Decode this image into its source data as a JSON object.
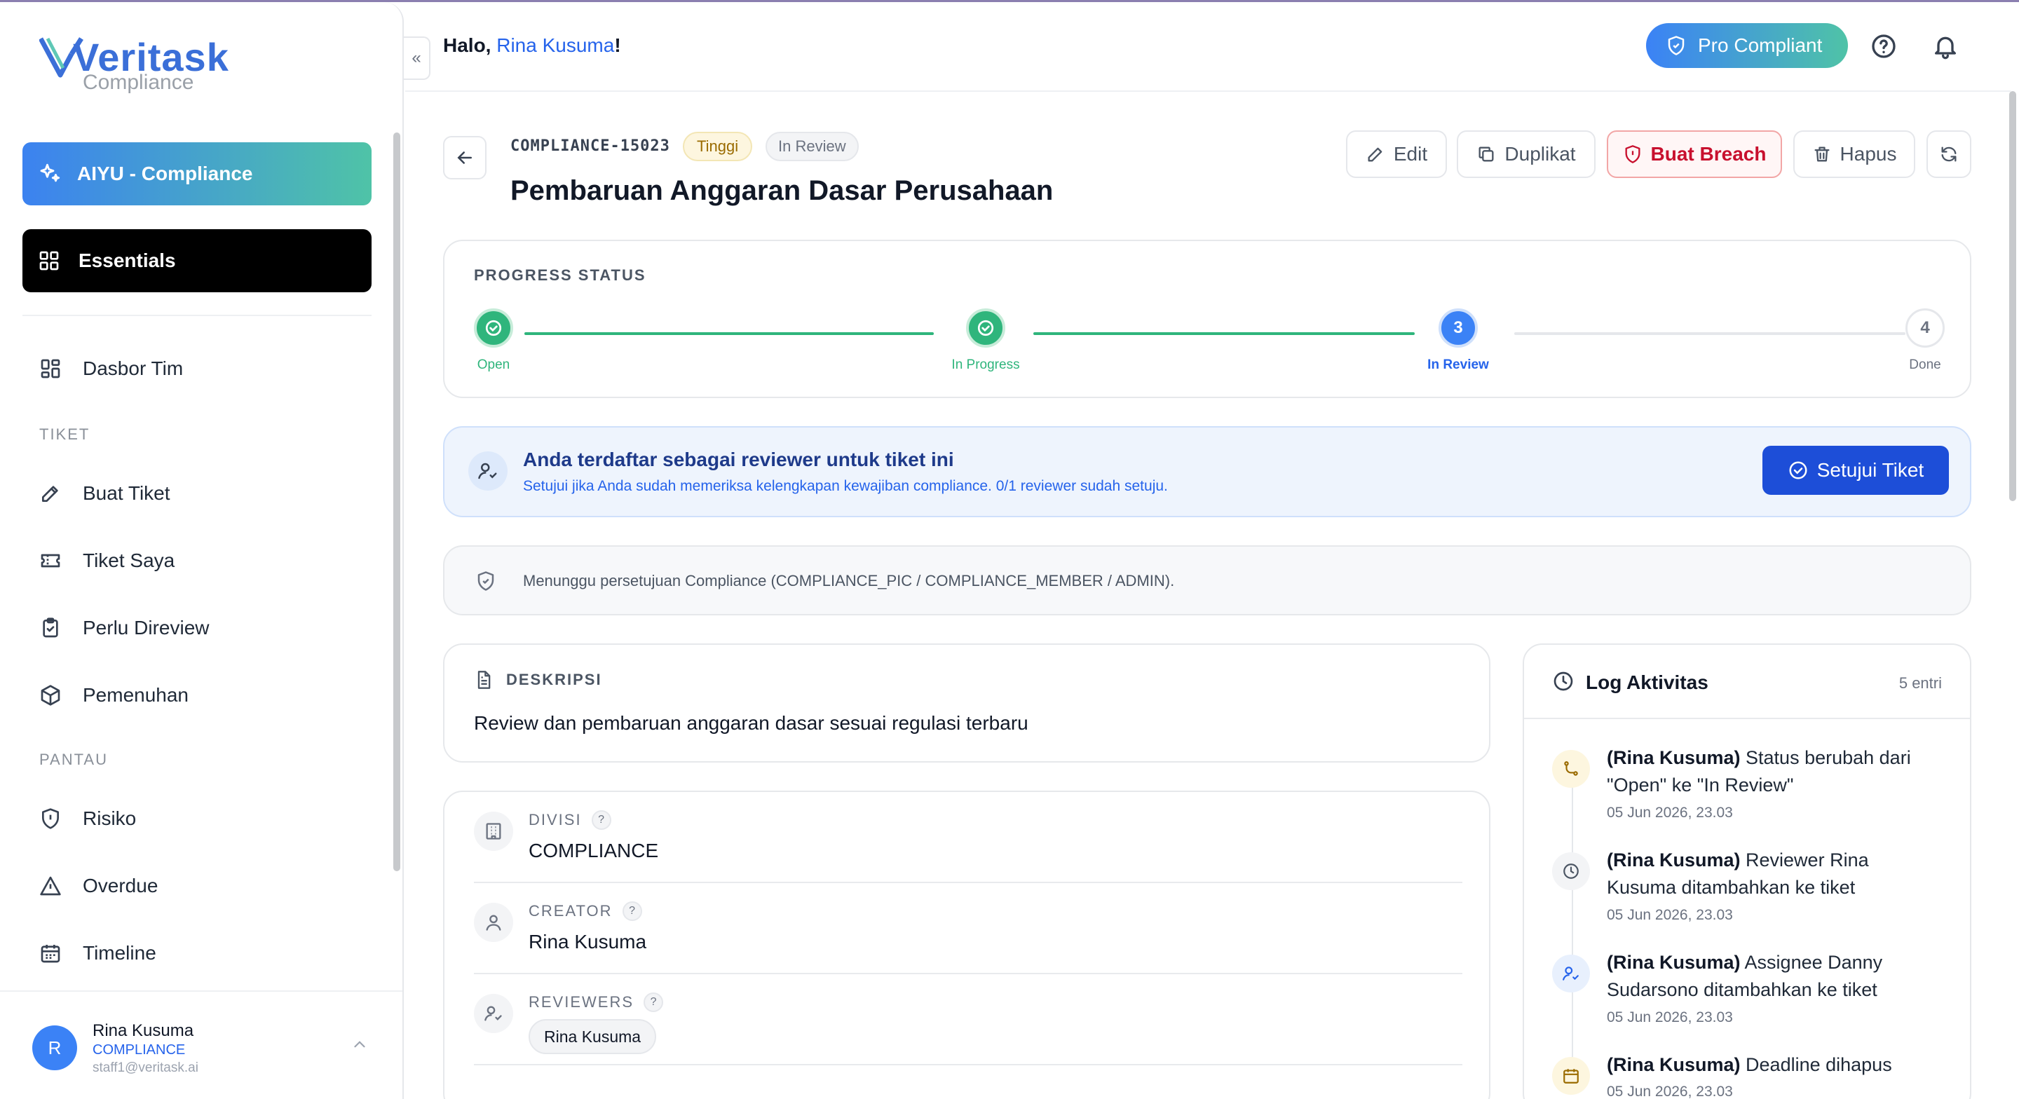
{
  "brand": {
    "name": "Veritask",
    "sub": "Compliance"
  },
  "sidebar": {
    "aiyu_label": "AIYU - Compliance",
    "essentials_label": "Essentials",
    "dashboard_label": "Dasbor Tim",
    "section_tiket": "TIKET",
    "items_tiket": [
      {
        "label": "Buat Tiket",
        "icon": "pencil-icon"
      },
      {
        "label": "Tiket Saya",
        "icon": "ticket-icon"
      },
      {
        "label": "Perlu Direview",
        "icon": "clipboard-icon"
      },
      {
        "label": "Pemenuhan",
        "icon": "package-icon"
      }
    ],
    "section_pantau": "PANTAU",
    "items_pantau": [
      {
        "label": "Risiko",
        "icon": "shield-icon"
      },
      {
        "label": "Overdue",
        "icon": "warning-icon"
      },
      {
        "label": "Timeline",
        "icon": "calendar-icon"
      }
    ],
    "collapse_glyph": "«",
    "user": {
      "initial": "R",
      "name": "Rina Kusuma",
      "division": "COMPLIANCE",
      "email": "staff1@veritask.ai"
    }
  },
  "header": {
    "greet_prefix": "Halo, ",
    "greet_name": "Rina Kusuma",
    "greet_suffix": "!",
    "plan_label": "Pro Compliant"
  },
  "ticket": {
    "id": "COMPLIANCE-15023",
    "priority": "Tinggi",
    "status": "In Review",
    "title": "Pembaruan Anggaran Dasar Perusahaan",
    "actions": {
      "edit": "Edit",
      "duplicate": "Duplikat",
      "breach": "Buat Breach",
      "delete": "Hapus"
    }
  },
  "progress": {
    "label": "PROGRESS STATUS",
    "steps": [
      {
        "label": "Open",
        "state": "done",
        "num": ""
      },
      {
        "label": "In Progress",
        "state": "done",
        "num": ""
      },
      {
        "label": "In Review",
        "state": "active",
        "num": "3"
      },
      {
        "label": "Done",
        "state": "todo",
        "num": "4"
      }
    ]
  },
  "reviewer": {
    "title": "Anda terdaftar sebagai reviewer untuk tiket ini",
    "subtitle": "Setujui jika Anda sudah memeriksa kelengkapan kewajiban compliance. 0/1 reviewer sudah setuju.",
    "approve_label": "Setujui Tiket"
  },
  "waiting": {
    "text": "Menunggu persetujuan Compliance (COMPLIANCE_PIC / COMPLIANCE_MEMBER / ADMIN)."
  },
  "description": {
    "label": "DESKRIPSI",
    "body": "Review dan pembaruan anggaran dasar sesuai regulasi terbaru"
  },
  "meta": {
    "divisi_label": "DIVISI",
    "divisi_value": "COMPLIANCE",
    "creator_label": "CREATOR",
    "creator_value": "Rina Kusuma",
    "reviewers_label": "REVIEWERS",
    "reviewers": [
      "Rina Kusuma"
    ],
    "help_glyph": "?"
  },
  "log": {
    "title": "Log Aktivitas",
    "count": "5 entri",
    "entries": [
      {
        "actor": "(Rina Kusuma)",
        "text": " Status berubah dari \"Open\" ke \"In Review\"",
        "time": "05 Jun 2026, 23.03",
        "icon": "git-branch-icon"
      },
      {
        "actor": "(Rina Kusuma)",
        "text": " Reviewer Rina Kusuma ditambahkan ke tiket",
        "time": "05 Jun 2026, 23.03",
        "icon": "clock-icon"
      },
      {
        "actor": "(Rina Kusuma)",
        "text": " Assignee Danny Sudarsono ditambahkan ke tiket",
        "time": "05 Jun 2026, 23.03",
        "icon": "user-check-icon"
      },
      {
        "actor": "(Rina Kusuma)",
        "text": " Deadline dihapus",
        "time": "05 Jun 2026, 23.03",
        "icon": "calendar-icon"
      }
    ]
  },
  "colors": {
    "accent": "#2563eb",
    "success": "#2fb57c",
    "danger": "#c8102e",
    "gradient_start": "#3c82f0",
    "gradient_end": "#4fc3a7"
  }
}
